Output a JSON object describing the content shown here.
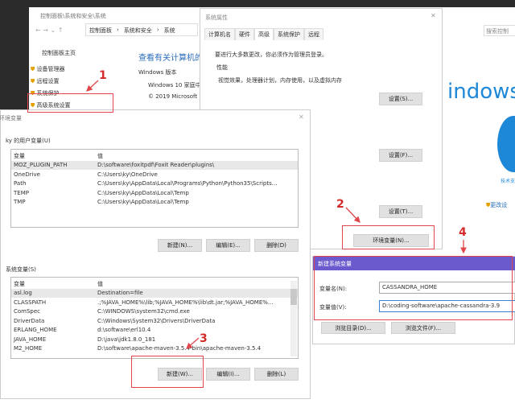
{
  "control_panel": {
    "breadcrumb_title": "控制面板\\系统和安全\\系统",
    "path": [
      "控制面板",
      "系统和安全",
      "系统"
    ],
    "search_placeholder": "搜索控制",
    "home": "控制面板主页",
    "links": [
      "设备管理器",
      "远程设置",
      "系统保护",
      "高级系统设置"
    ],
    "heading": "查看有关计算机的",
    "edition_label": "Windows 版本",
    "edition": "Windows 10 家庭中",
    "copyright": "© 2019 Microsoft",
    "logo_text": "indows",
    "support": "技术支",
    "change_settings": "更改设"
  },
  "sys_props": {
    "title": "系统属性",
    "tabs": [
      "计算机名",
      "硬件",
      "高级",
      "系统保护",
      "远程"
    ],
    "active_tab": 2,
    "admin_note": "要进行大多数更改，你必须作为管理员登录。",
    "perf_label": "性能",
    "perf_desc": "视觉效果，处理器计划，内存使用，以及虚拟内存",
    "btn_s": "设置(S)...",
    "btn_f": "设置(F)...",
    "btn_t": "设置(T)...",
    "env_btn": "环境变量(N)..."
  },
  "env_dialog": {
    "title": "环境变量",
    "user_label": "ky 的用户变量(U)",
    "col_var": "变量",
    "col_val": "值",
    "user_vars": [
      [
        "MOZ_PLUGIN_PATH",
        "D:\\software\\foxitpdf\\Foxit Reader\\plugins\\"
      ],
      [
        "OneDrive",
        "C:\\Users\\ky\\OneDrive"
      ],
      [
        "Path",
        "C:\\Users\\ky\\AppData\\Local\\Programs\\Python\\Python35\\Scripts..."
      ],
      [
        "TEMP",
        "C:\\Users\\ky\\AppData\\Local\\Temp"
      ],
      [
        "TMP",
        "C:\\Users\\ky\\AppData\\Local\\Temp"
      ]
    ],
    "user_buttons": [
      "新建(N)...",
      "编辑(E)...",
      "删除(D)"
    ],
    "sys_label": "系统变量(S)",
    "sys_vars": [
      [
        "asl.log",
        "Destination=file"
      ],
      [
        "CLASSPATH",
        ".;%JAVA_HOME%\\lib;%JAVA_HOME%\\lib\\dt.jar;%JAVA_HOME%..."
      ],
      [
        "ComSpec",
        "C:\\WINDOWS\\system32\\cmd.exe"
      ],
      [
        "DriverData",
        "C:\\Windows\\System32\\Drivers\\DriverData"
      ],
      [
        "ERLANG_HOME",
        "d:\\software\\erl10.4"
      ],
      [
        "JAVA_HOME",
        "D:\\java\\jdk1.8.0_181"
      ],
      [
        "M2_HOME",
        "D:\\software\\apache-maven-3.5.4-bin\\apache-maven-3.5.4"
      ]
    ],
    "sys_buttons": [
      "新建(W)...",
      "编辑(I)...",
      "删除(L)"
    ]
  },
  "new_var": {
    "title": "新建系统变量",
    "name_label": "变量名(N):",
    "name_value": "CASSANDRA_HOME",
    "value_label": "变量值(V):",
    "value_value": "D:\\coding-software\\apache-cassandra-3.9",
    "browse_dir": "浏览目录(D)...",
    "browse_file": "浏览文件(F)..."
  },
  "annotations": [
    "1",
    "2",
    "3",
    "4"
  ],
  "colors": {
    "accent": "#6a5acd",
    "annotation": "#e0474c"
  }
}
